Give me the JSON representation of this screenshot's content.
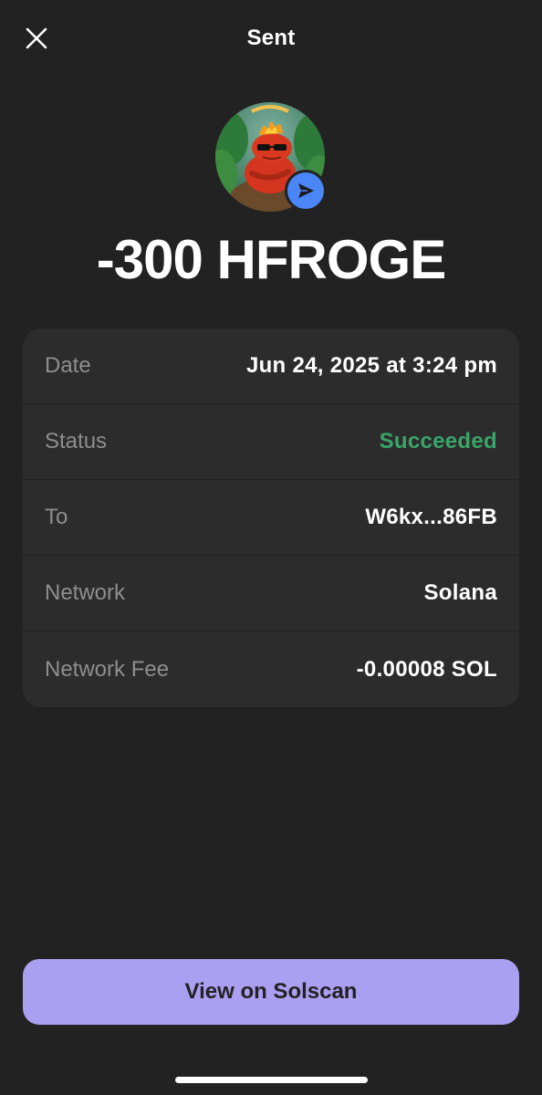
{
  "header": {
    "title": "Sent",
    "close_icon": "close-icon"
  },
  "token": {
    "avatar_icon": "token-avatar-image",
    "badge_icon": "send-icon",
    "badge_color": "#4a86f7",
    "amount": "-300 HFROGE"
  },
  "details": {
    "rows": [
      {
        "label": "Date",
        "value": "Jun 24, 2025 at 3:24 pm"
      },
      {
        "label": "Status",
        "value": "Succeeded",
        "color": "#3aa569"
      },
      {
        "label": "To",
        "value": "W6kx...86FB"
      },
      {
        "label": "Network",
        "value": "Solana"
      },
      {
        "label": "Network Fee",
        "value": "-0.00008 SOL"
      }
    ]
  },
  "actions": {
    "view_on_explorer_label": "View on Solscan",
    "button_color": "#ab9ff2"
  },
  "theme": {
    "background": "#222222",
    "card_background": "#2c2c2c"
  }
}
